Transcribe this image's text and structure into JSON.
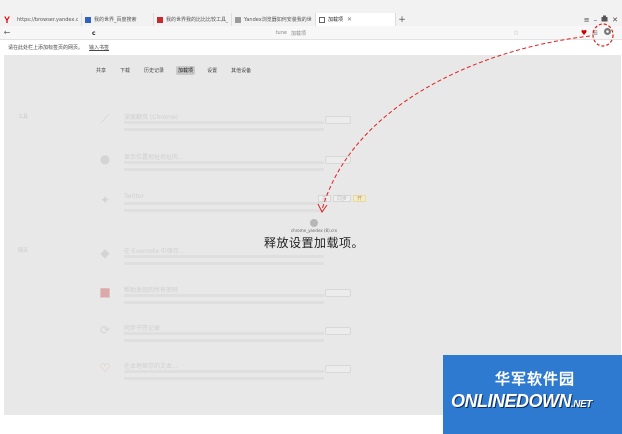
{
  "tabs": [
    {
      "label": "https://browser.yandex.com",
      "active": false
    },
    {
      "label": "我的世界_百度搜索",
      "active": false
    },
    {
      "label": "我的世界我的比比比较工具_历史价格",
      "active": false
    },
    {
      "label": "Yandex浏览器如何安装我的世界...",
      "active": false
    },
    {
      "label": "加载项",
      "active": true
    }
  ],
  "new_tab": "+",
  "window_controls": {
    "menu": "≡",
    "minimize": "–",
    "close": "✕"
  },
  "omnibox": {
    "site": "tune",
    "page": "加载项"
  },
  "bookmarks_bar": {
    "hint": "请在此处栏上添加标签页的网页。",
    "import_link": "输入书签"
  },
  "nav": {
    "items": [
      "共享",
      "下载",
      "历史记录",
      "加载项",
      "设置",
      "其他设备"
    ],
    "active_index": 3
  },
  "sections": {
    "tools": "工具",
    "web": "网页"
  },
  "extensions": [
    {
      "title": "深度翻页 (Chrome)"
    },
    {
      "title": "显示位置地址地址的..."
    },
    {
      "title": "Twitter",
      "buttons": [
        "关",
        "同步",
        "开"
      ]
    },
    {
      "title": "在 Evernote 中保存..."
    },
    {
      "title": "帮助发现的所有密码"
    },
    {
      "title": "同步书签记录"
    },
    {
      "title": "在本地保存的文本..."
    }
  ],
  "drop_zone": {
    "file_name": "chrome_yandex (8).crx",
    "text": "释放设置加载项。"
  },
  "watermark": {
    "cn": "华军软件园",
    "en": "ONLINEDOWN",
    "tld": ".NET"
  },
  "colors": {
    "annotation": "#e02020",
    "watermark_bg": "#2e7ad0",
    "content_bg": "#e8e8e8"
  }
}
